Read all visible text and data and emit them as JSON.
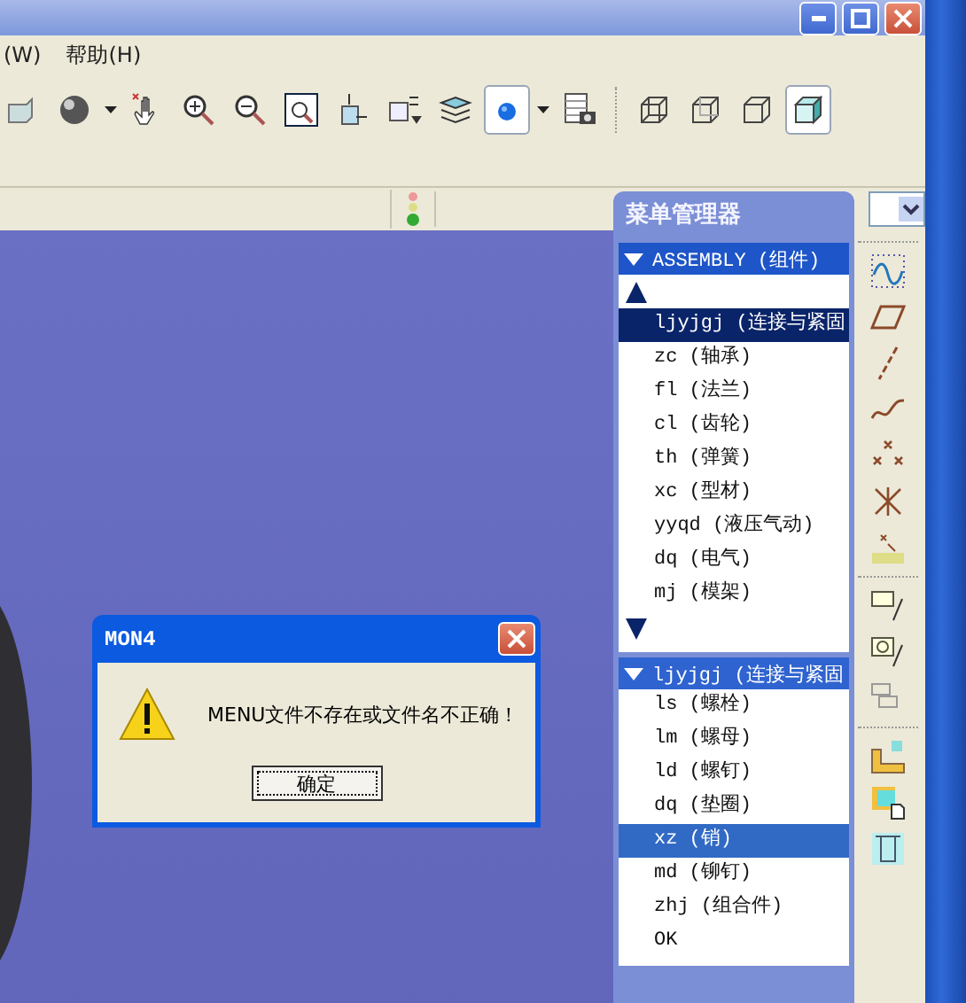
{
  "menu_bar": [
    "(W)",
    "帮助(H)"
  ],
  "toolbar": [
    [
      {
        "kind": "box",
        "selected": false,
        "dropdown": false
      },
      {
        "kind": "sphere",
        "selected": false,
        "dropdown": true
      },
      {
        "kind": "pan",
        "selected": false,
        "dropdown": false
      },
      {
        "kind": "zoom-in",
        "selected": false,
        "dropdown": false
      },
      {
        "kind": "zoom-out",
        "selected": false,
        "dropdown": false
      },
      {
        "kind": "refit",
        "selected": false,
        "dropdown": false
      },
      {
        "kind": "orient",
        "selected": false,
        "dropdown": false
      },
      {
        "kind": "annotate",
        "selected": false,
        "dropdown": false
      },
      {
        "kind": "layers",
        "selected": false,
        "dropdown": false
      },
      {
        "kind": "spin",
        "selected": true,
        "dropdown": true
      },
      {
        "kind": "views",
        "selected": false,
        "dropdown": false
      }
    ],
    [
      {
        "kind": "wireframe",
        "selected": false,
        "dropdown": false
      },
      {
        "kind": "hidden",
        "selected": false,
        "dropdown": false
      },
      {
        "kind": "nohidden",
        "selected": false,
        "dropdown": false
      },
      {
        "kind": "shaded",
        "selected": true,
        "dropdown": false
      }
    ]
  ],
  "menu_manager": {
    "title": "菜单管理器",
    "sections": [
      {
        "header": "ASSEMBLY (组件)",
        "active": false,
        "scroll_arrows": true,
        "items": [
          {
            "label": "ljyjgj (连接与紧固",
            "selected": true
          },
          {
            "label": "zc (轴承)",
            "selected": false
          },
          {
            "label": "fl (法兰)",
            "selected": false
          },
          {
            "label": "cl (齿轮)",
            "selected": false
          },
          {
            "label": "th (弹簧)",
            "selected": false
          },
          {
            "label": "xc (型材)",
            "selected": false
          },
          {
            "label": "yyqd (液压气动)",
            "selected": false
          },
          {
            "label": "dq (电气)",
            "selected": false
          },
          {
            "label": "mj (模架)",
            "selected": false
          }
        ]
      },
      {
        "header": "ljyjgj (连接与紧固",
        "active": true,
        "scroll_arrows": false,
        "items": [
          {
            "label": "ls (螺栓)",
            "selected": false
          },
          {
            "label": "lm (螺母)",
            "selected": false
          },
          {
            "label": "ld (螺钉)",
            "selected": false
          },
          {
            "label": "dq (垫圈)",
            "selected": false
          },
          {
            "label": "xz (销)",
            "selected": true
          },
          {
            "label": "md (铆钉)",
            "selected": false
          },
          {
            "label": "zhj (组合件)",
            "selected": false
          },
          {
            "label": "OK",
            "selected": false
          }
        ]
      }
    ]
  },
  "dialog": {
    "title": "MON4",
    "message": "MENU文件不存在或文件名不正确！",
    "button": "确定"
  }
}
